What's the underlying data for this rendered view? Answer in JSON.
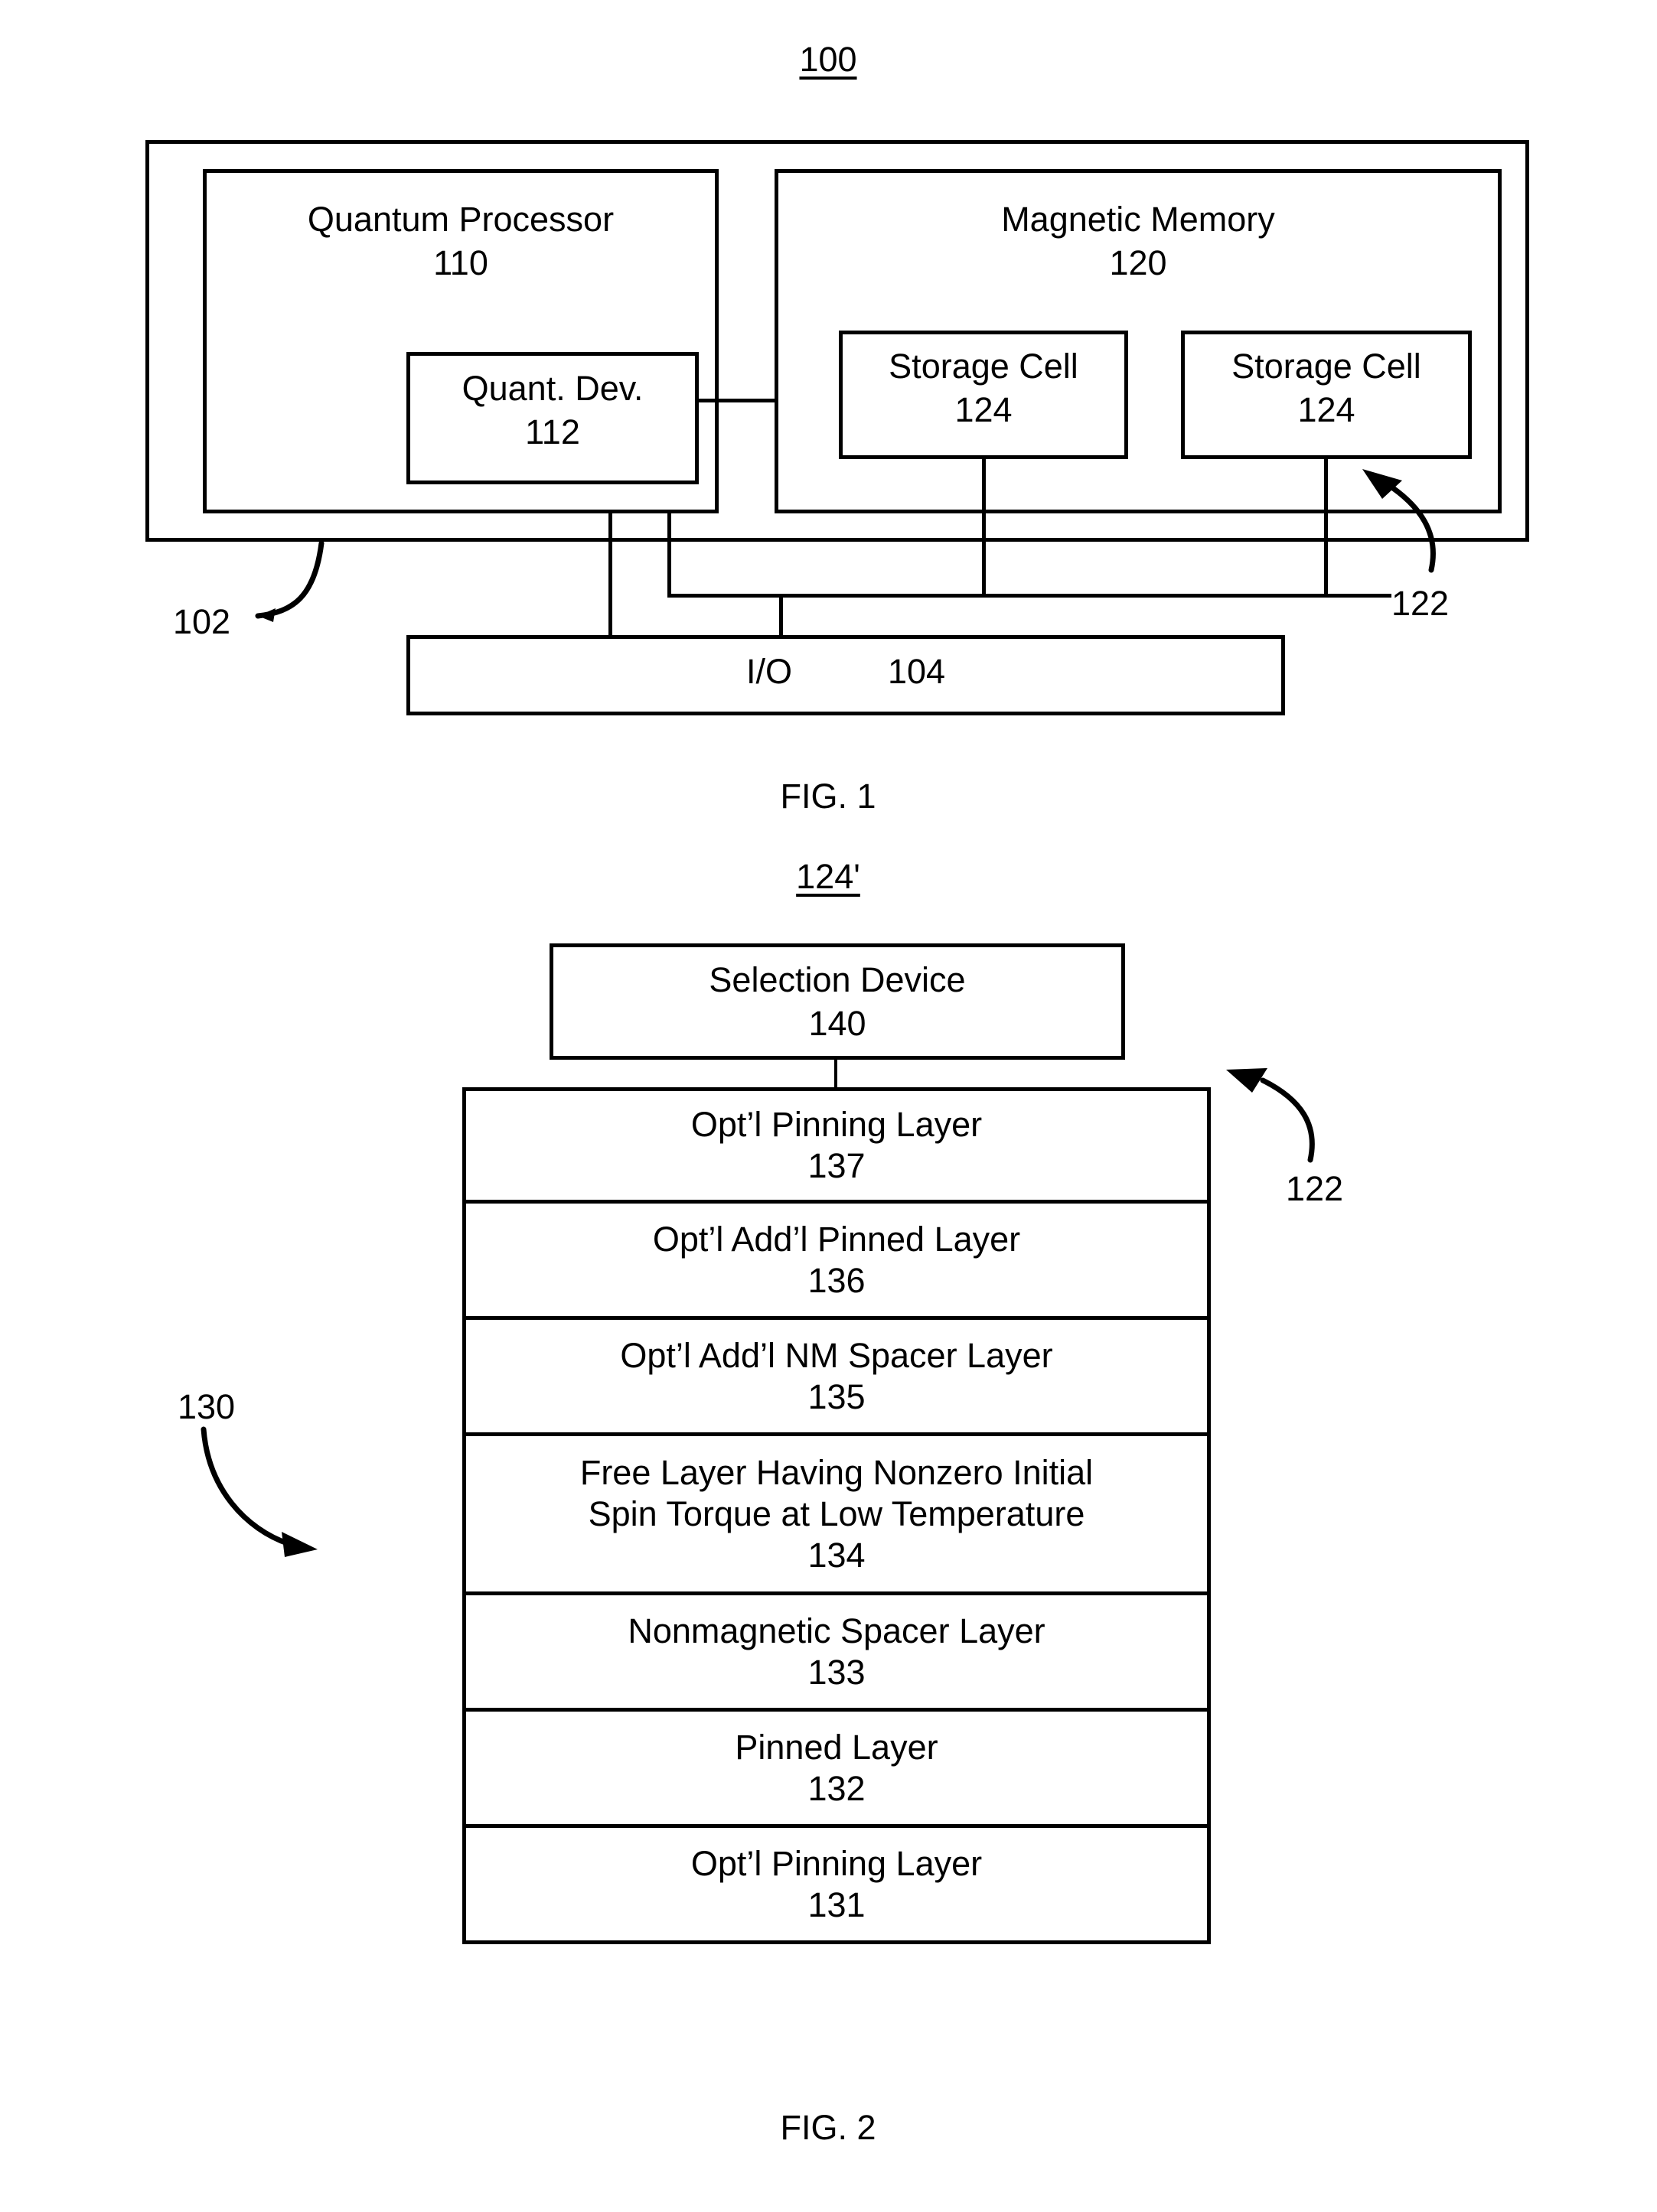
{
  "figure1": {
    "ref_number": "100",
    "caption": "FIG. 1",
    "system_ref": "102",
    "memory_cell_ref": "122",
    "quantum_processor": {
      "name": "Quantum Processor",
      "number": "110"
    },
    "quantum_device": {
      "name": "Quant. Dev.",
      "number": "112"
    },
    "magnetic_memory": {
      "name": "Magnetic Memory",
      "number": "120"
    },
    "storage_cell_1": {
      "name": "Storage Cell",
      "number": "124"
    },
    "storage_cell_2": {
      "name": "Storage Cell",
      "number": "124"
    },
    "io": {
      "name": "I/O",
      "number": "104",
      "text": "I/O          104"
    }
  },
  "figure2": {
    "ref_number": "124'",
    "caption": "FIG. 2",
    "stack_ref": "130",
    "cell_ref": "122",
    "selection_device": {
      "name": "Selection Device",
      "number": "140"
    },
    "layers": [
      {
        "name": "Opt’l Pinning Layer",
        "number": "137"
      },
      {
        "name": "Opt’l Add’l Pinned Layer",
        "number": "136"
      },
      {
        "name": "Opt’l Add’l NM Spacer Layer",
        "number": "135"
      },
      {
        "name": "Free Layer Having Nonzero Initial\nSpin Torque at Low Temperature",
        "number": "134"
      },
      {
        "name": "Nonmagnetic Spacer Layer",
        "number": "133"
      },
      {
        "name": "Pinned Layer",
        "number": "132"
      },
      {
        "name": "Opt’l Pinning Layer",
        "number": "131"
      }
    ]
  },
  "colors": {
    "ink": "#000000",
    "paper": "#ffffff"
  }
}
